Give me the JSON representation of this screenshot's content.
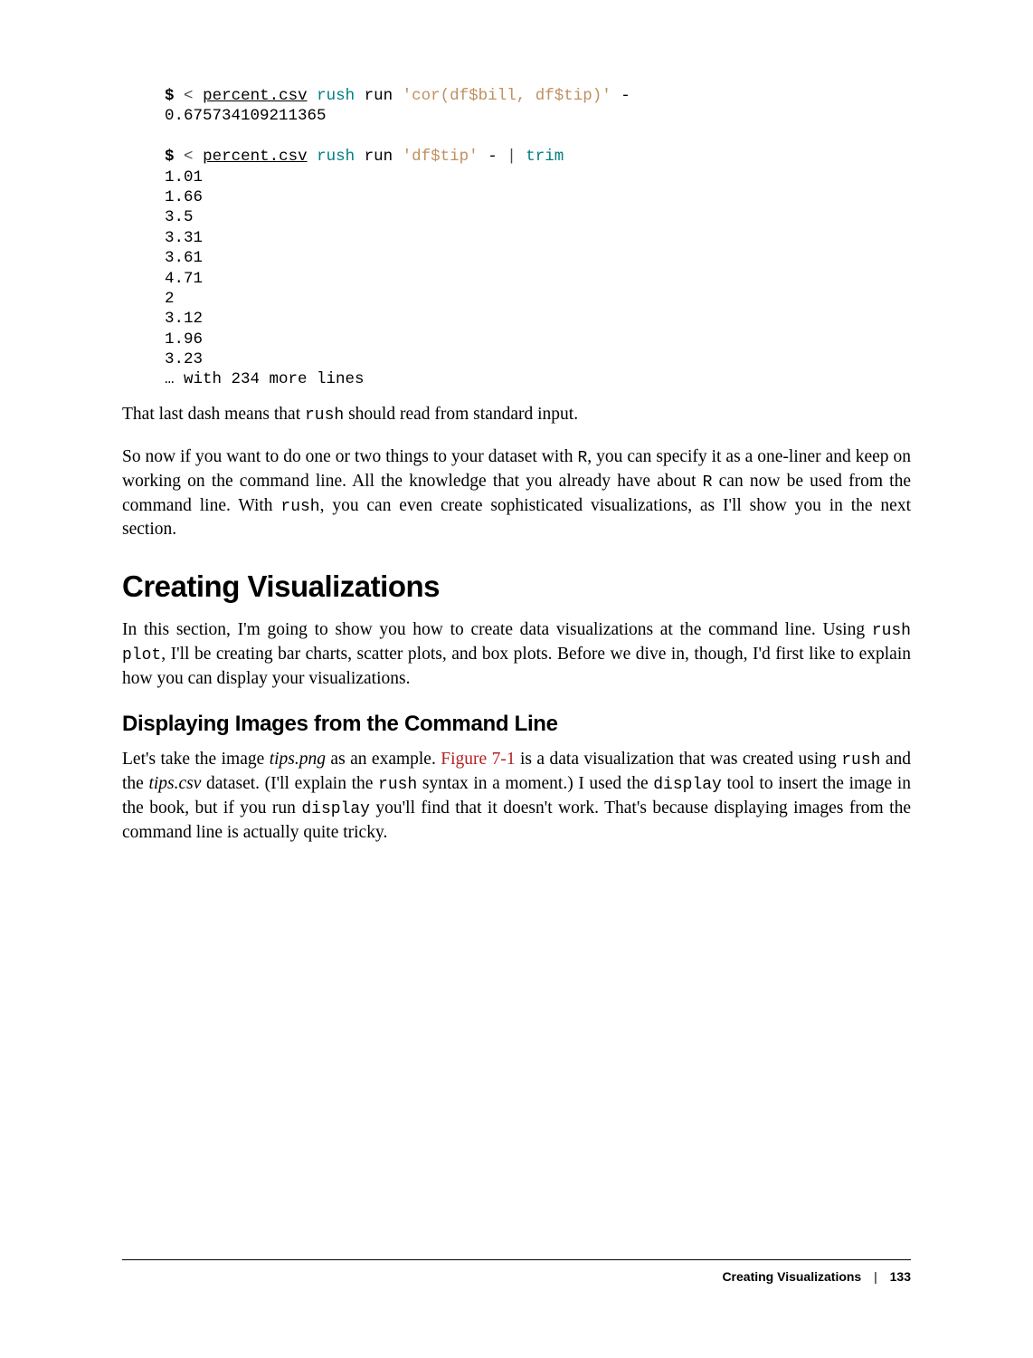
{
  "code1": {
    "prompt": "$",
    "redirect": "<",
    "file": "percent.csv",
    "rush": "rush",
    "run": "run",
    "expr": "'cor(df$bill, df$tip)'",
    "dash": "-",
    "output": "0.675734109211365"
  },
  "code2": {
    "prompt": "$",
    "redirect": "<",
    "file": "percent.csv",
    "rush": "rush",
    "run": "run",
    "expr": "'df$tip'",
    "dash": "-",
    "pipe": "|",
    "trim": "trim",
    "outputs": [
      "1.01",
      "1.66",
      "3.5",
      "3.31",
      "3.61",
      "4.71",
      "2",
      "3.12",
      "1.96",
      "3.23"
    ],
    "more": "… with 234 more lines"
  },
  "para1": {
    "t1": "That last dash means that ",
    "c1": "rush",
    "t2": " should read from standard input."
  },
  "para2": {
    "t1": "So now if you want to do one or two things to your dataset with ",
    "c1": "R",
    "t2": ", you can specify it as a one-liner and keep on working on the command line. All the knowledge that you already have about ",
    "c2": "R",
    "t3": " can now be used from the command line. With ",
    "c3": "rush",
    "t4": ", you can even create sophisticated visualizations, as I'll show you in the next section."
  },
  "heading1": "Creating Visualizations",
  "para3": {
    "t1": "In this section, I'm going to show you how to create data visualizations at the command line. Using ",
    "c1": "rush plot",
    "t2": ", I'll be creating bar charts, scatter plots, and box plots. Before we dive in, though, I'd first like to explain how you can display your visualizations."
  },
  "heading2": "Displaying Images from the Command Line",
  "para4": {
    "t1": "Let's take the image ",
    "i1": "tips.png",
    "t2": " as an example. ",
    "ref1": "Figure 7-1",
    "t3": " is a data visualization that was created using ",
    "c1": "rush",
    "t4": " and the ",
    "i2": "tips.csv",
    "t5": " dataset. (I'll explain the ",
    "c2": "rush",
    "t6": " syntax in a moment.) I used the ",
    "c3": "display",
    "t7": " tool to insert the image in the book, but if you run ",
    "c4": "display",
    "t8": " you'll find that it doesn't work. That's because displaying images from the command line is actually quite tricky."
  },
  "footer": {
    "section": "Creating Visualizations",
    "divider": "|",
    "page": "133"
  }
}
